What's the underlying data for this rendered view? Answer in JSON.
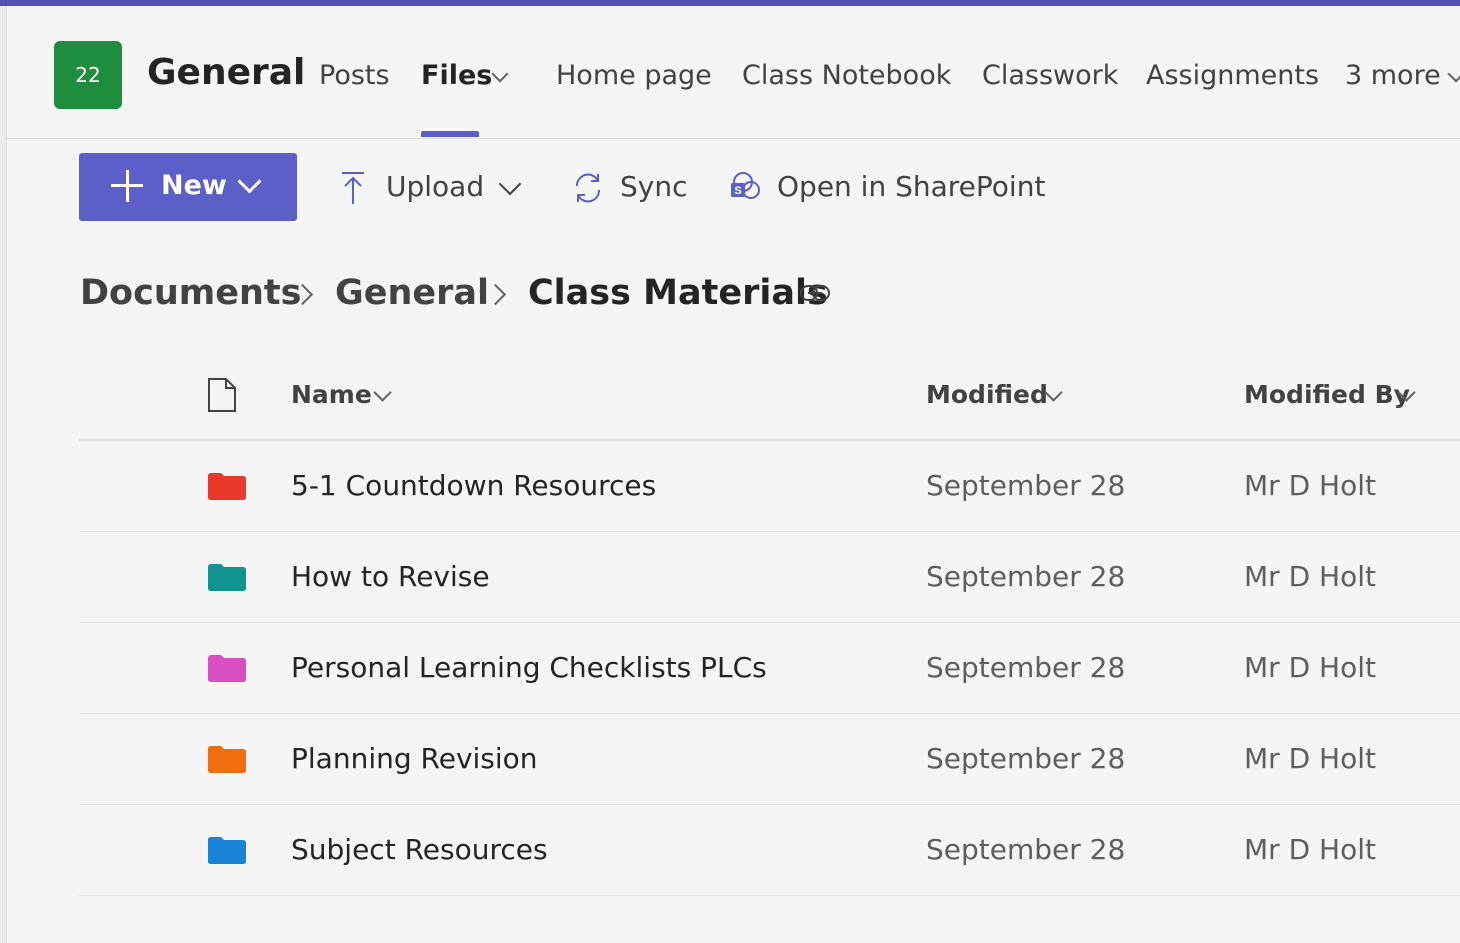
{
  "header": {
    "team_avatar_text": "22",
    "channel_title": "General",
    "tabs": [
      {
        "label": "Posts",
        "active": false
      },
      {
        "label": "Files",
        "active": true
      },
      {
        "label": "Home page",
        "active": false
      },
      {
        "label": "Class Notebook",
        "active": false
      },
      {
        "label": "Classwork",
        "active": false
      },
      {
        "label": "Assignments",
        "active": false
      },
      {
        "label": "3 more",
        "active": false
      }
    ]
  },
  "toolbar": {
    "new_label": "New",
    "upload_label": "Upload",
    "sync_label": "Sync",
    "open_sharepoint_label": "Open in SharePoint"
  },
  "breadcrumb": {
    "items": [
      "Documents",
      "General",
      "Class Materials"
    ]
  },
  "table": {
    "columns": {
      "name": "Name",
      "modified": "Modified",
      "modified_by": "Modified By"
    },
    "rows": [
      {
        "name": "5-1 Countdown Resources",
        "modified": "September 28",
        "modified_by": "Mr D Holt",
        "folder_color": "#e8382c"
      },
      {
        "name": "How to Revise",
        "modified": "September 28",
        "modified_by": "Mr D Holt",
        "folder_color": "#13938f"
      },
      {
        "name": "Personal Learning Checklists PLCs",
        "modified": "September 28",
        "modified_by": "Mr D Holt",
        "folder_color": "#d94fc1"
      },
      {
        "name": "Planning Revision",
        "modified": "September 28",
        "modified_by": "Mr D Holt",
        "folder_color": "#ee6d0e"
      },
      {
        "name": "Subject Resources",
        "modified": "September 28",
        "modified_by": "Mr D Holt",
        "folder_color": "#1883d7"
      }
    ]
  },
  "colors": {
    "accent": "#5b5fc7",
    "team_avatar": "#1e8e3e"
  },
  "icons": [
    "plus-icon",
    "upload-icon",
    "sync-icon",
    "sharepoint-icon",
    "link-icon",
    "file-icon",
    "folder-icon",
    "chevron-down-icon",
    "chevron-right-icon"
  ]
}
